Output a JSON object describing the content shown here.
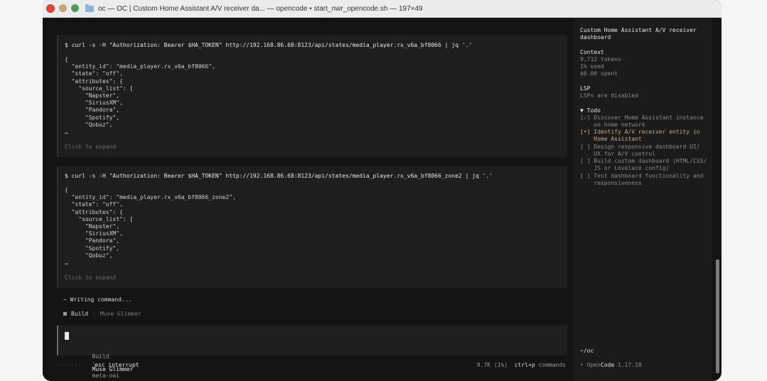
{
  "window": {
    "title": "oc — OC | Custom Home Assistant A/V receiver da... — opencode • start_nwr_opencode.sh — 197×49"
  },
  "blocks": [
    {
      "command": "$ curl -s -H \"Authorization: Bearer $HA_TOKEN\" http://192.168.86.68:8123/api/states/media_player.rx_v6a_bf8066 | jq '.'",
      "output": "{\n  \"entity_id\": \"media_player.rx_v6a_bf8066\",\n  \"state\": \"off\",\n  \"attributes\": {\n    \"source_list\": [\n      \"Napster\",\n      \"SiriusXM\",\n      \"Pandora\",\n      \"Spotify\",\n      \"Qobuz\",\n…",
      "expand": "Click to expand"
    },
    {
      "command": "$ curl -s -H \"Authorization: Bearer $HA_TOKEN\" http://192.168.86.68:8123/api/states/media_player.rx_v6a_bf8066_zone2 | jq '.'",
      "output": "{\n  \"entity_id\": \"media_player.rx_v6a_bf8066_zone2\",\n  \"state\": \"off\",\n  \"attributes\": {\n    \"source_list\": [\n      \"Napster\",\n      \"SiriusXM\",\n      \"Pandora\",\n      \"Spotify\",\n      \"Qobuz\",\n…",
      "expand": "Click to expand"
    }
  ],
  "writing": "~ Writing command...",
  "build": {
    "label": "Build",
    "sep": "·",
    "model": "Muse Glimmer"
  },
  "input": {
    "agent": "Build",
    "sep": "·",
    "model": "Muse Glimmer",
    "provider": "meta-oai"
  },
  "status": {
    "dots": "·······",
    "interrupt": "esc interrupt",
    "usage": "9.7K (1%)",
    "shortcut": "ctrl+p",
    "shortcut_label": "commands"
  },
  "sidebar": {
    "title": "Custom Home Assistant A/V receiver\ndashboard",
    "context_head": "Context",
    "context_lines": "9,712 tokens\n1% used\n$0.00 spent",
    "lsp_head": "LSP",
    "lsp_text": "LSPs are disabled",
    "todo_head": "▼ Todo",
    "todos": [
      {
        "text": "[✓] Discover Home Assistant instance\n    on home network",
        "active": false
      },
      {
        "text": "[•] Identify A/V receiver entity in\n    Home Assistant",
        "active": true
      },
      {
        "text": "[ ] Design responsive dashboard UI/\n    UX for A/V control",
        "active": false
      },
      {
        "text": "[ ] Build custom dashboard (HTML/CSS/\n    JS or Lovelace config)",
        "active": false
      },
      {
        "text": "[ ] Test dashboard functionality and\n    responsiveness",
        "active": false
      }
    ],
    "cwd": "~/oc",
    "footer_dot": "•",
    "footer_open": "Open",
    "footer_code": "Code",
    "footer_version": "1.17.18"
  }
}
